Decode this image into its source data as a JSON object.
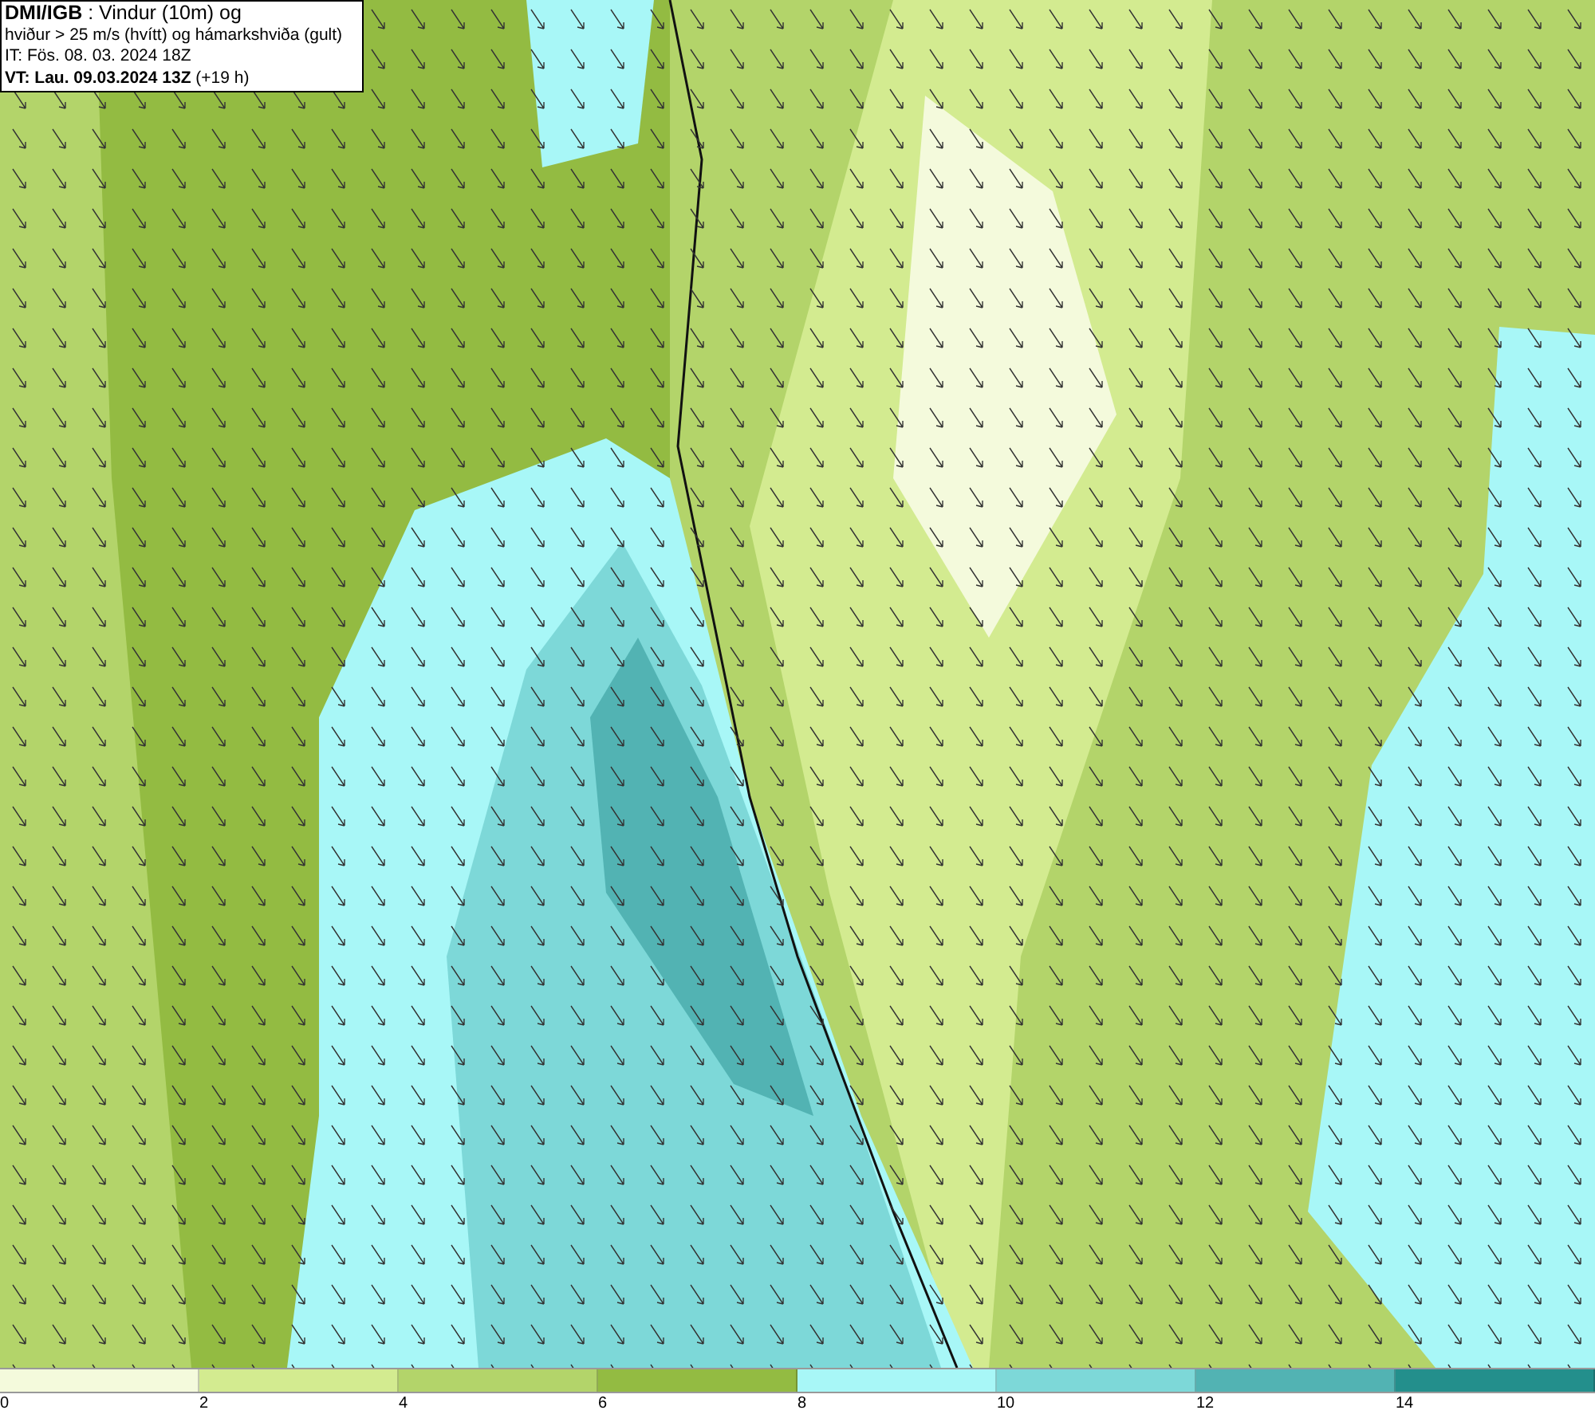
{
  "header": {
    "lines": [
      "**DMI/IGB** : Vindur (10m) og",
      "hviður > 25 m/s (hvítt) og hámarkshviða (gult)",
      "IT: Fös. 08. 03. 2024 18Z",
      "**VT: Lau. 09.03.2024 13Z** (+19 h)"
    ]
  },
  "legend": {
    "bins": [
      {
        "label": "0",
        "color": "#f4fadc"
      },
      {
        "label": "2",
        "color": "#d3eb90"
      },
      {
        "label": "4",
        "color": "#b3d46a"
      },
      {
        "label": "6",
        "color": "#93bb42"
      },
      {
        "label": "8",
        "color": "#a8f7f7"
      },
      {
        "label": "10",
        "color": "#7dd8d8"
      },
      {
        "label": "12",
        "color": "#52b3b3"
      },
      {
        "label": "14",
        "color": "#238f8c"
      }
    ]
  }
}
